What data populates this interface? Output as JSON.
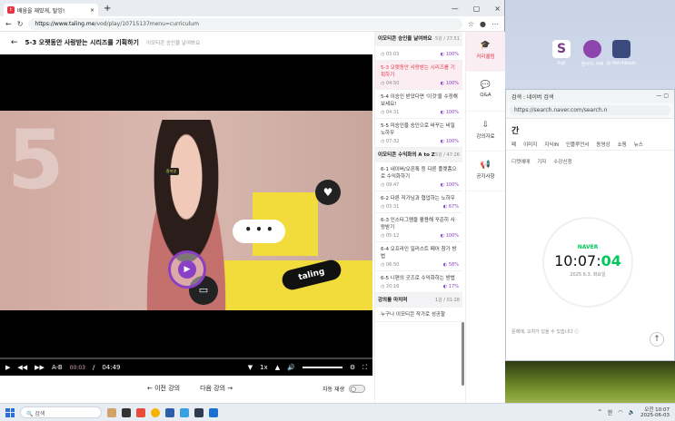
{
  "desktop": {
    "icons": [
      {
        "label": "Sqil",
        "color": "#7b3a8c"
      },
      {
        "label": "앤서치 서버",
        "color": "#8e44ad"
      },
      {
        "label": "Jb Patchbook",
        "color": "#3a4a7c"
      }
    ]
  },
  "right_browser": {
    "title": "검색 : 네이버 검색",
    "url": "https://search.naver.com/search.n",
    "heading": "간",
    "tabs": [
      "페",
      "이미지",
      "지식iN",
      "인플루언서",
      "동영상",
      "쇼핑",
      "뉴스"
    ],
    "subs": [
      "디켓예매",
      "기자",
      "수강신청"
    ],
    "clock": {
      "brand": "NAVER",
      "time_main": "10:07:",
      "time_sec": "04",
      "date": "2025.6.3. 화요일"
    },
    "note": "문제에, 오차가 있을 수 있습니다 ⓘ"
  },
  "browser": {
    "tab_title": "배움을 재밌게, 탈잉!",
    "url_domain": "https://www.taling.me",
    "url_path": "/vod/play/10715137menu=curriculum",
    "page_title": "5-3 오랫동안 사랑받는 시리즈를 기획하기",
    "page_subtitle": "이모티콘 승인율 날여봐요"
  },
  "player": {
    "badge": "환저영",
    "brand_sticker": "taling",
    "bubble": "• • •",
    "current_time": "00:03",
    "separator": "/",
    "duration": "04:49",
    "ab_label": "A-B",
    "speed": "1x"
  },
  "nav": {
    "prev": "← 이전 강의",
    "next": "다음 강의 →",
    "autoplay": "자동 재생"
  },
  "curriculum": [
    {
      "type": "section",
      "title": "이모티콘 승인을 날여봐요",
      "meta": "5강 / 27:51"
    },
    {
      "type": "item",
      "title": "",
      "time": "03:03",
      "pct": "100%",
      "active": false
    },
    {
      "type": "item",
      "title": "5-3 오랫동안 사랑받는 시리즈를 기획하기",
      "time": "04:50",
      "pct": "100%",
      "active": true
    },
    {
      "type": "item",
      "title": "5-4 이승인 받았다면 '이것'을 수정해 보세요!",
      "time": "04:31",
      "pct": "100%",
      "active": false
    },
    {
      "type": "item",
      "title": "5-5 미승인을 승인으로 바꾸는 비밀 노하우",
      "time": "07:32",
      "pct": "100%",
      "active": false
    },
    {
      "type": "section",
      "title": "이모티콘 수익화의 A to Z",
      "meta": "5강 / 47:26"
    },
    {
      "type": "item",
      "title": "6-1 네이버/오픈톡 등 다른 플랫폼으로 수익화하기",
      "time": "09:47",
      "pct": "100%",
      "active": false
    },
    {
      "type": "item",
      "title": "6-2 다른 작가님과 협업하는 노하우",
      "time": "03:31",
      "pct": "67%",
      "active": false
    },
    {
      "type": "item",
      "title": "6-3 인스타그램을 활용해 꾸준히 사랑받기",
      "time": "05:12",
      "pct": "100%",
      "active": false
    },
    {
      "type": "item",
      "title": "6-4 오프라인 일러스트 페어 참가 방법",
      "time": "06:50",
      "pct": "58%",
      "active": false
    },
    {
      "type": "item",
      "title": "6-5 니편의 굿즈로 수익화하는 방법",
      "time": "20:16",
      "pct": "17%",
      "active": false
    },
    {
      "type": "section",
      "title": "강의를 마치며",
      "meta": "1강 / 01:28"
    },
    {
      "type": "item",
      "title": "누구나 이모티콘 작가로 성공할",
      "time": "",
      "pct": "",
      "active": false
    }
  ],
  "side_panel": [
    {
      "label": "커리큘럼",
      "icon": "cap-icon",
      "glyph": "🎓",
      "on": true
    },
    {
      "label": "Q&A",
      "icon": "chat-icon",
      "glyph": "💬",
      "on": false
    },
    {
      "label": "강의자료",
      "icon": "download-icon",
      "glyph": "⇩",
      "on": false
    },
    {
      "label": "공지사항",
      "icon": "megaphone-icon",
      "glyph": "📢",
      "on": false
    }
  ],
  "taskbar": {
    "search": "검색",
    "lang": "한",
    "time": "오전 10:07",
    "date": "2025-06-03"
  },
  "colors": {
    "accent": "#e63346",
    "purple": "#8b3fc4",
    "naver": "#03c75a",
    "yellow": "#f2dc3b"
  }
}
